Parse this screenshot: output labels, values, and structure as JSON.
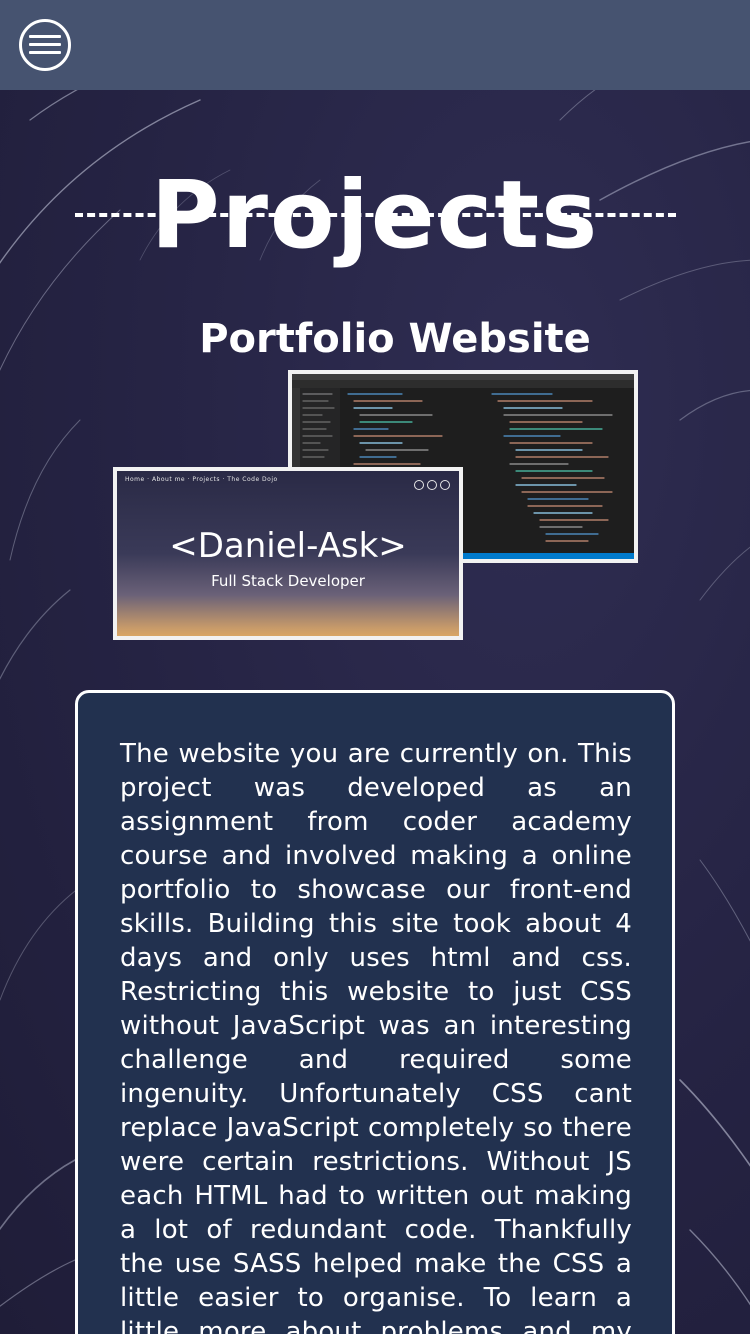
{
  "header": {
    "menu_icon": "hamburger-menu-icon"
  },
  "page": {
    "title": "Projects"
  },
  "project": {
    "title": "Portfolio Website",
    "screenshot_home": {
      "nav_text": "Home · About me · Projects · The Code Dojo",
      "name": "<Daniel-Ask>",
      "role": "Full Stack Developer"
    },
    "description": "The website you are currently on. This project was developed as an assignment from coder academy course and involved making a online portfolio to showcase our front-end skills. Building this site took about 4 days and only uses html and css. Restricting this website to just CSS without JavaScript was an interesting challenge and required some ingenuity. Unfortunately CSS cant replace JavaScript completely so there were certain restrictions. Without JS each HTML had to written out making a lot of redundant code. Thankfully the use SASS helped make the CSS a little easier to organise. To learn a little more about problems and my coding"
  },
  "colors": {
    "header_bg": "#465370",
    "page_bg": "#2a2848",
    "card_bg": "#22314f",
    "text": "#ffffff"
  }
}
